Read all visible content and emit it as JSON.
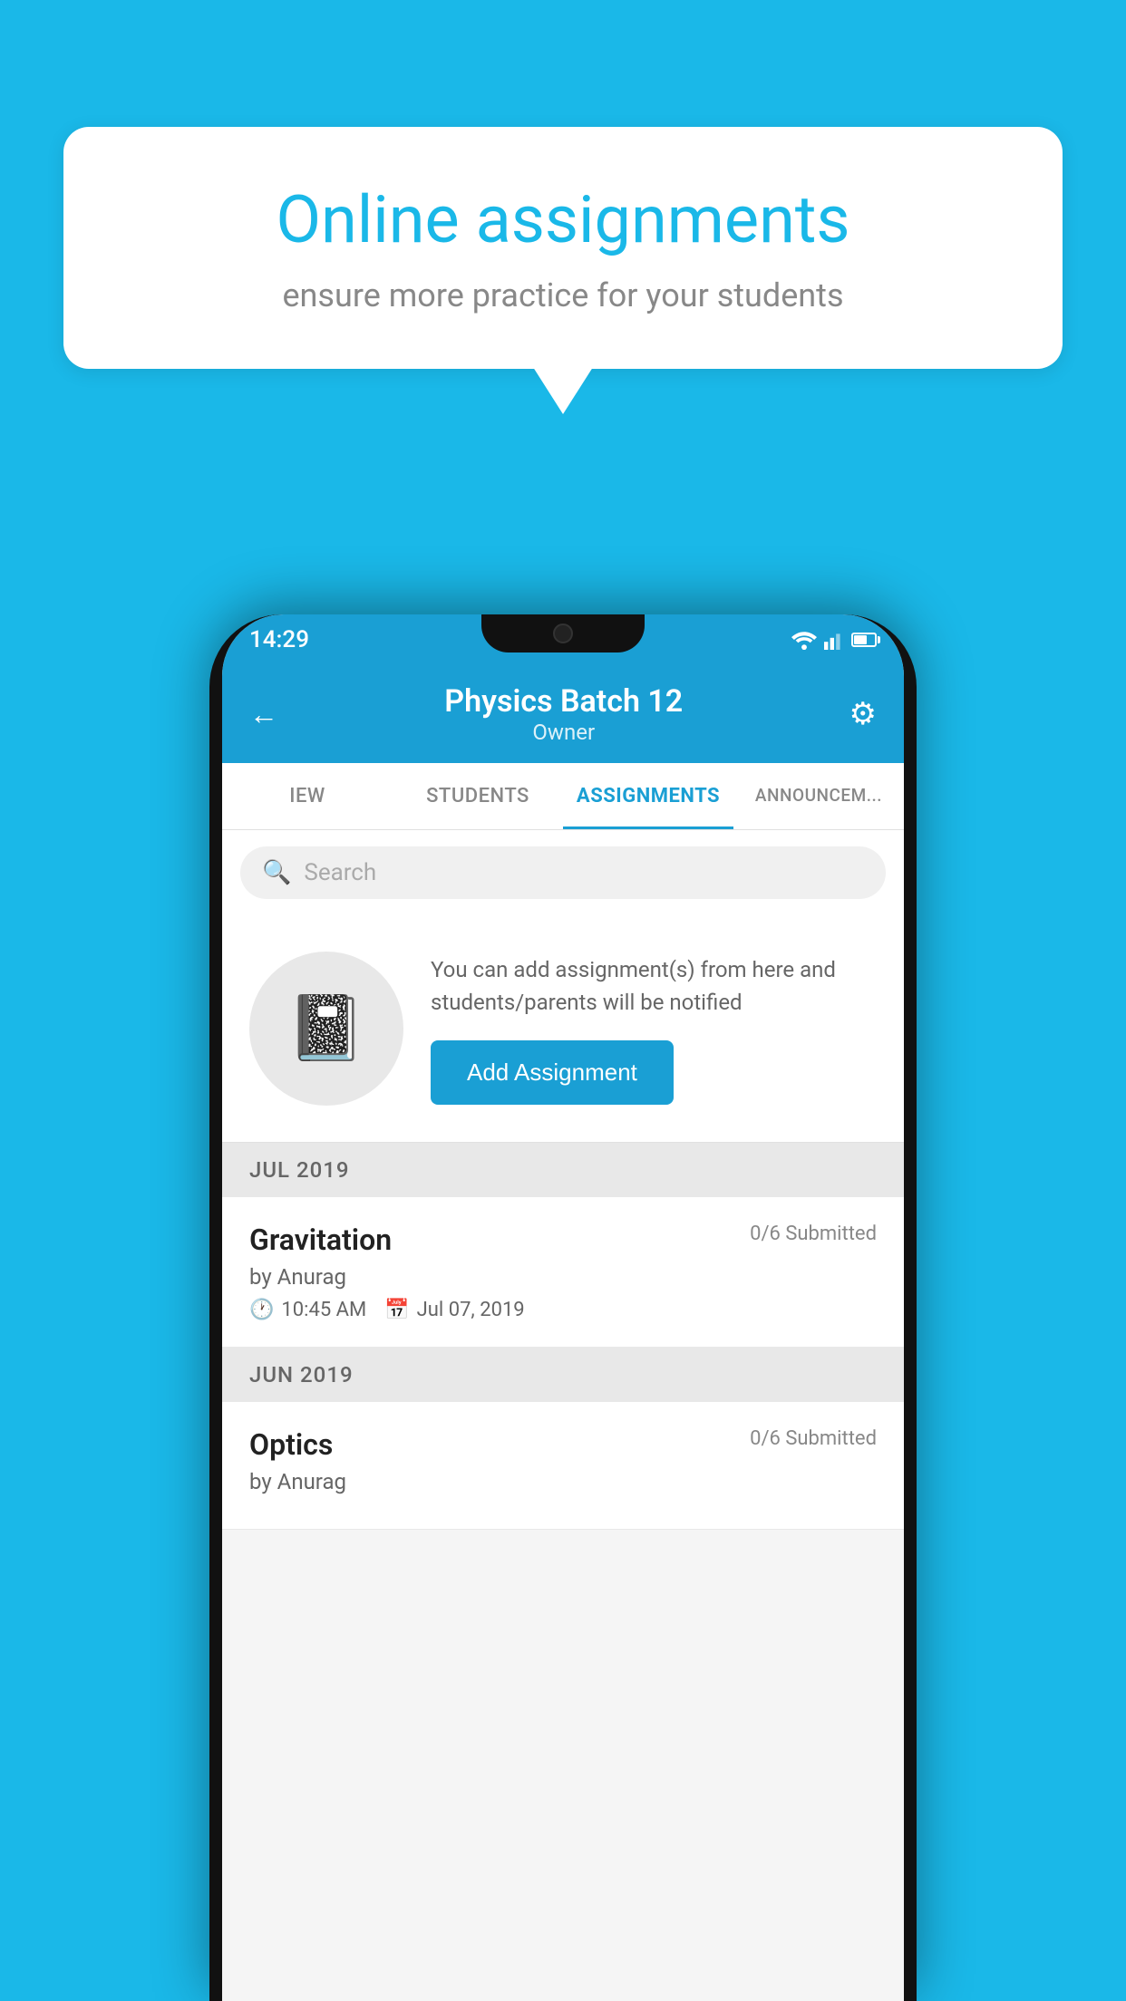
{
  "background_color": "#1ab8e8",
  "speech_bubble": {
    "title": "Online assignments",
    "subtitle": "ensure more practice for your students"
  },
  "status_bar": {
    "time": "14:29"
  },
  "header": {
    "title": "Physics Batch 12",
    "subtitle": "Owner"
  },
  "tabs": [
    {
      "label": "IEW",
      "active": false
    },
    {
      "label": "STUDENTS",
      "active": false
    },
    {
      "label": "ASSIGNMENTS",
      "active": true
    },
    {
      "label": "ANNOUNCEM...",
      "active": false
    }
  ],
  "search": {
    "placeholder": "Search"
  },
  "promo": {
    "text": "You can add assignment(s) from here and students/parents will be notified",
    "button_label": "Add Assignment"
  },
  "sections": [
    {
      "month_label": "JUL 2019",
      "assignments": [
        {
          "name": "Gravitation",
          "submitted": "0/6 Submitted",
          "author": "by Anurag",
          "time": "10:45 AM",
          "date": "Jul 07, 2019"
        }
      ]
    },
    {
      "month_label": "JUN 2019",
      "assignments": [
        {
          "name": "Optics",
          "submitted": "0/6 Submitted",
          "author": "by Anurag",
          "time": "",
          "date": ""
        }
      ]
    }
  ]
}
